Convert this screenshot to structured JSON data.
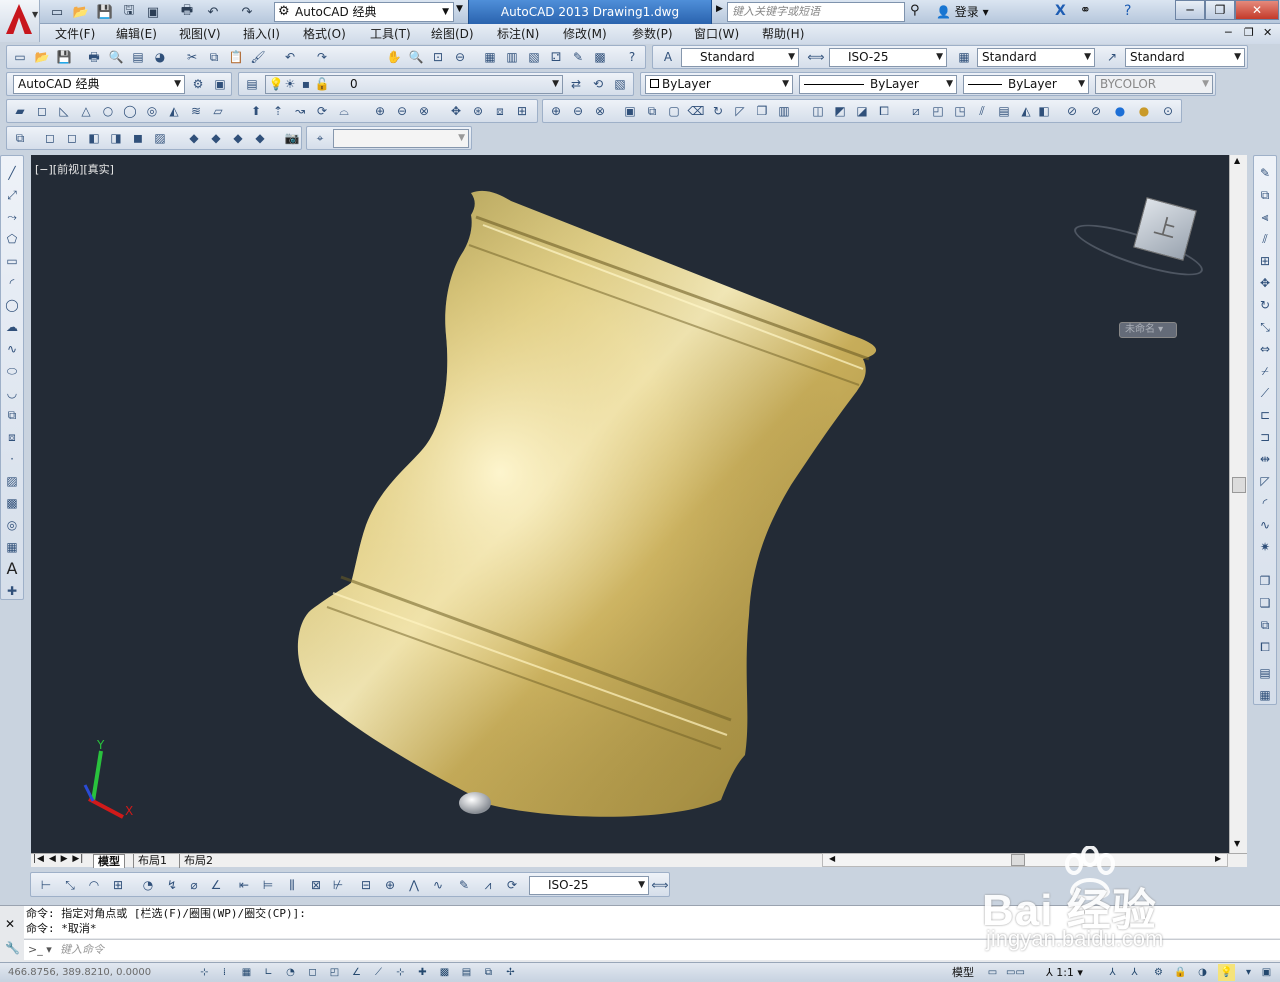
{
  "app": {
    "title": "AutoCAD 2013    Drawing1.dwg",
    "workspace": "AutoCAD 经典",
    "search_placeholder": "键入关键字或短语",
    "login": "登录"
  },
  "menu": [
    "文件(F)",
    "编辑(E)",
    "视图(V)",
    "插入(I)",
    "格式(O)",
    "工具(T)",
    "绘图(D)",
    "标注(N)",
    "修改(M)",
    "参数(P)",
    "窗口(W)",
    "帮助(H)"
  ],
  "styles": {
    "text_style": "Standard",
    "dim_style": "ISO-25",
    "table_style": "Standard",
    "mleader_style": "Standard"
  },
  "layers": {
    "workspace2": "AutoCAD 经典",
    "current_layer": "0",
    "color": "ByLayer",
    "linetype": "ByLayer",
    "lineweight": "ByLayer",
    "plotstyle": "BYCOLOR"
  },
  "viewport": {
    "label": "[−][前视][真实]",
    "viewcube_face": "上",
    "ucs_name": "未命名",
    "axis_y": "Y",
    "axis_x": "X"
  },
  "tabs": [
    "模型",
    "布局1",
    "布局2"
  ],
  "dim_toolbar_style": "ISO-25",
  "command": {
    "history": [
      "命令: 指定对角点或 [栏选(F)/圈围(WP)/圈交(CP)]:",
      "命令: *取消*"
    ],
    "placeholder": "键入命令"
  },
  "status": {
    "coords": "466.8756, 389.8210, 0.0000",
    "space": "模型",
    "scale": "1:1"
  },
  "watermark": {
    "brand": "Bai 经验",
    "url": "jingyan.baidu.com"
  },
  "colors": {
    "viewport_bg": "#232b36",
    "model_gold": "#c9b25e",
    "title_blue": "#2a63ae",
    "logo_red": "#c8161d"
  }
}
